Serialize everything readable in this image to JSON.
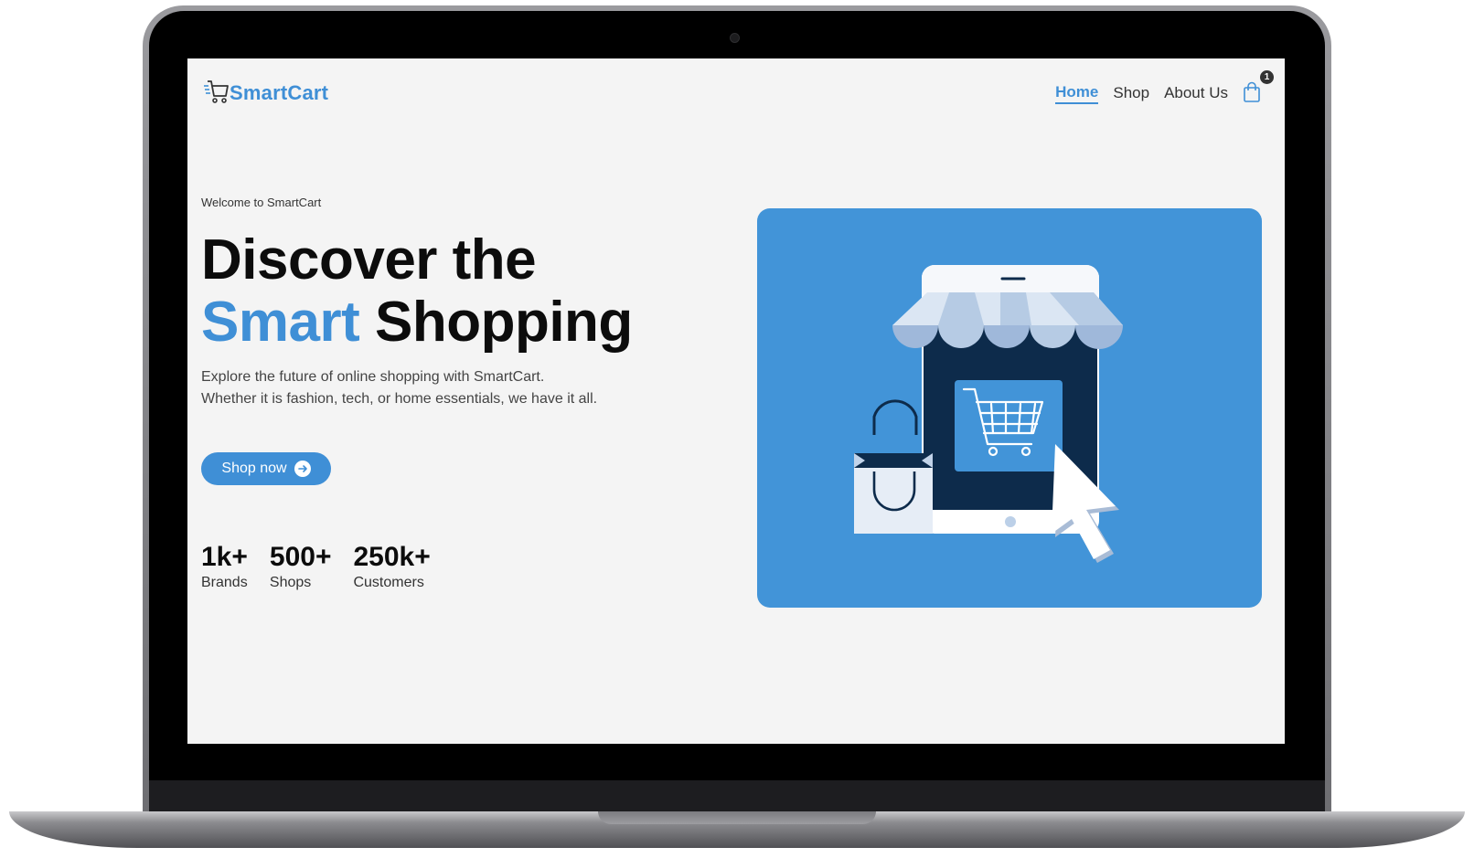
{
  "brand": {
    "name": "SmartCart",
    "color": "#3f8fd6"
  },
  "nav": {
    "links": [
      "Home",
      "Shop",
      "About Us"
    ],
    "active": "Home",
    "cart_count": "1"
  },
  "hero": {
    "welcome": "Welcome to SmartCart",
    "headline_line1": "Discover the",
    "headline_accent": "Smart",
    "headline_rest": "Shopping",
    "subtext_line1": "Explore the future of online shopping with SmartCart.",
    "subtext_line2": "Whether it is fashion, tech, or home essentials, we have it all.",
    "cta_label": "Shop now"
  },
  "stats": [
    {
      "value": "1k+",
      "label": "Brands"
    },
    {
      "value": "500+",
      "label": "Shops"
    },
    {
      "value": "250k+",
      "label": "Customers"
    }
  ],
  "icons": {
    "logo": "shopping-cart-icon",
    "cta": "arrow-right-circle-icon",
    "cart": "shopping-bag-icon"
  },
  "colors": {
    "accent": "#3f8fd6",
    "illustration_bg": "#4294d8",
    "screen_bg": "#f4f4f4"
  }
}
